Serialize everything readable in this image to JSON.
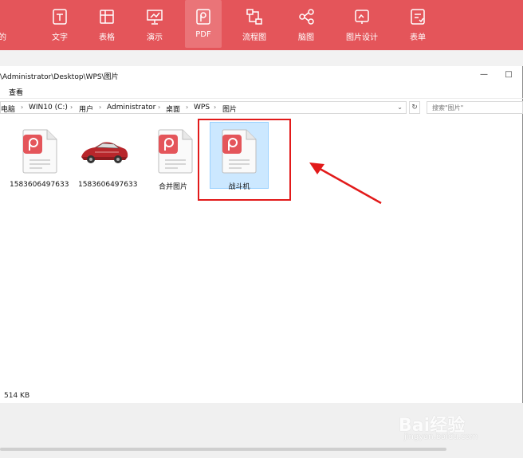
{
  "toolbar": {
    "partial_label": "的",
    "items": [
      {
        "label": "文字",
        "icon": "text-doc-icon"
      },
      {
        "label": "表格",
        "icon": "table-icon"
      },
      {
        "label": "演示",
        "icon": "presentation-icon"
      },
      {
        "label": "PDF",
        "icon": "pdf-icon"
      },
      {
        "label": "流程图",
        "icon": "flowchart-icon"
      },
      {
        "label": "脑图",
        "icon": "mindmap-icon"
      },
      {
        "label": "图片设计",
        "icon": "image-design-icon"
      },
      {
        "label": "表单",
        "icon": "form-icon"
      }
    ],
    "active": "PDF",
    "bg_color": "#e4555a"
  },
  "window": {
    "title": "\\Administrator\\Desktop\\WPS\\图片",
    "minimize_symbol": "—",
    "maximize_symbol": "□"
  },
  "ribbon": {
    "tab_view": "查看"
  },
  "address": {
    "crumbs": [
      "电脑",
      "WIN10 (C:)",
      "用户",
      "Administrator",
      "桌面",
      "WPS",
      "图片"
    ],
    "separator": "›",
    "dropdown_symbol": "⌄",
    "refresh_symbol": "↻",
    "search_placeholder": "搜索\"图片\""
  },
  "files": [
    {
      "name": "1583606497633",
      "type": "pdf"
    },
    {
      "name": "1583606497633",
      "type": "image"
    },
    {
      "name": "合并图片",
      "type": "pdf"
    },
    {
      "name": "战斗机",
      "type": "pdf",
      "selected": true
    }
  ],
  "status": {
    "size": "514 KB"
  },
  "watermark": {
    "text": "Bai经验",
    "url": "jingyan.baidu.com"
  },
  "colors": {
    "highlight_box": "#e21a1a",
    "selection": "#cce8ff",
    "pdf_badge": "#e4555a"
  }
}
